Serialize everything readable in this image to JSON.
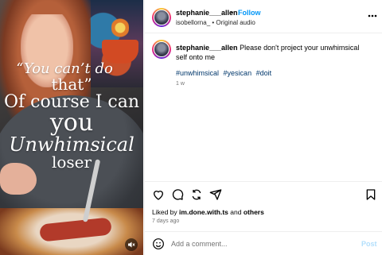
{
  "media": {
    "overlay_lines": [
      "“You can’t do",
      "that”",
      "Of course I can",
      "you",
      "Unwhimsical",
      "loser"
    ],
    "mute_icon": "speaker-muted-icon"
  },
  "header": {
    "username": "stephanie___allen",
    "separator": "•",
    "follow_label": "Follow",
    "audio_user": "isobellorna_",
    "audio_label": "Original audio",
    "more_icon": "more-horizontal-icon"
  },
  "caption": {
    "username": "stephanie___allen",
    "text": "Please don't project your unwhimsical self onto me",
    "hashtags": [
      "#unwhimsical",
      "#yesican",
      "#doit"
    ],
    "time_ago": "1 w"
  },
  "actions": {
    "icons": [
      "heart-icon",
      "comment-icon",
      "repost-icon",
      "share-icon",
      "bookmark-icon"
    ]
  },
  "likes": {
    "prefix": "Liked by",
    "user": "im.done.with.ts",
    "and": "and",
    "others": "others",
    "date": "7 days ago"
  },
  "comment": {
    "placeholder": "Add a comment...",
    "post_label": "Post"
  },
  "colors": {
    "accent": "#0095f6",
    "hashtag": "#00376b",
    "post_disabled": "#b2dffc",
    "muted_text": "#737373"
  }
}
